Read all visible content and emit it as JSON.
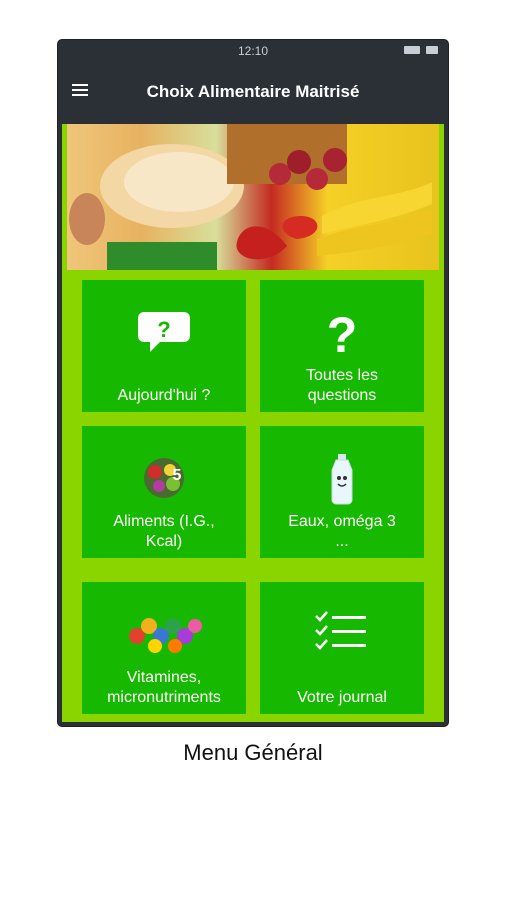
{
  "status": {
    "time": "12:10"
  },
  "appbar": {
    "title": "Choix Alimentaire Maitrisé"
  },
  "tiles": [
    {
      "label": "Aujourd'hui ?",
      "icon": "speech-bubble-question-icon"
    },
    {
      "label": "Toutes les questions",
      "icon": "question-mark-icon"
    },
    {
      "label": "Aliments (I.G., Kcal)",
      "icon": "food-basket-icon"
    },
    {
      "label": "Eaux, oméga 3 ...",
      "icon": "water-bottle-icon"
    },
    {
      "label": "Vitamines, micronutriments",
      "icon": "vitamin-balls-icon"
    },
    {
      "label": "Votre journal",
      "icon": "checklist-icon"
    }
  ],
  "caption": "Menu Général"
}
